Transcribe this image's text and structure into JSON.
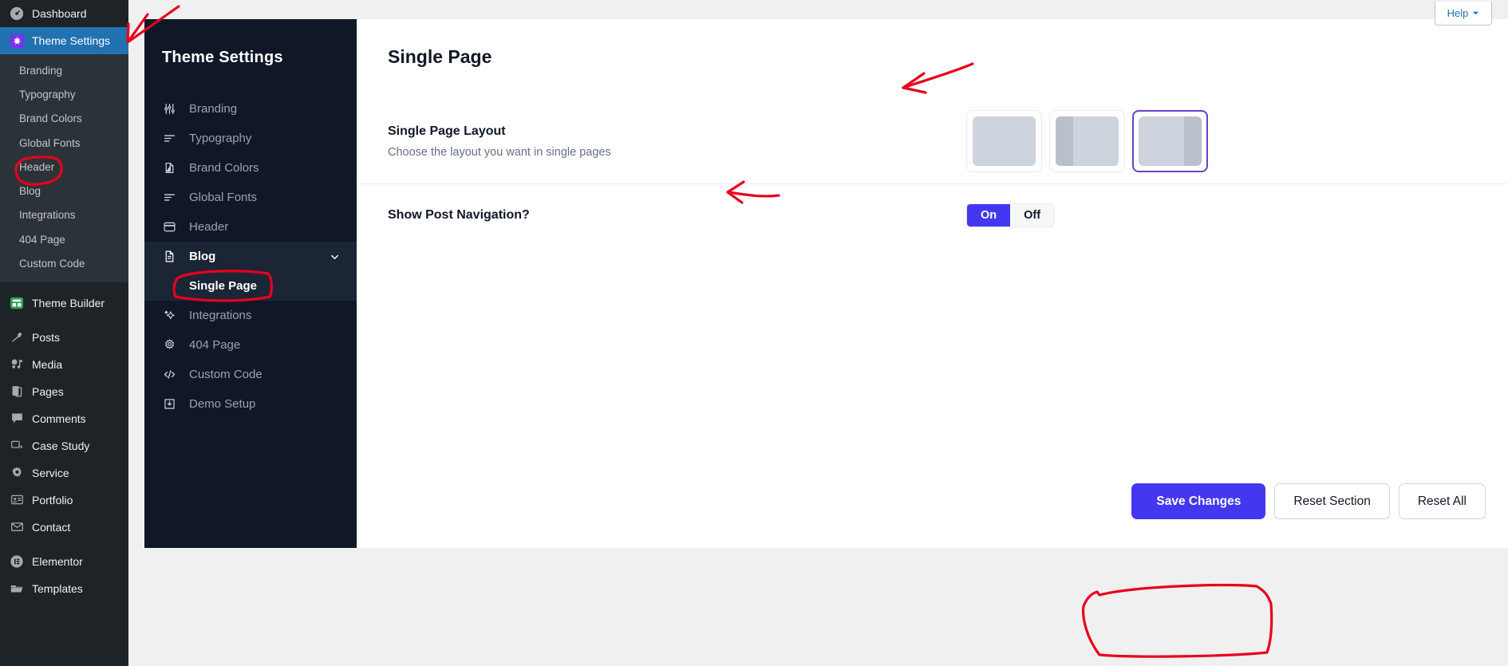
{
  "wp_sidebar": {
    "items": [
      {
        "label": "Dashboard",
        "icon": "dashboard-icon",
        "active": false
      },
      {
        "label": "Theme Settings",
        "icon": "theme-settings-icon",
        "active": true
      }
    ],
    "submenu": [
      {
        "label": "Branding"
      },
      {
        "label": "Typography"
      },
      {
        "label": "Brand Colors"
      },
      {
        "label": "Global Fonts"
      },
      {
        "label": "Header"
      },
      {
        "label": "Blog"
      },
      {
        "label": "Integrations"
      },
      {
        "label": "404 Page"
      },
      {
        "label": "Custom Code"
      }
    ],
    "items_after": [
      {
        "label": "Theme Builder",
        "icon": "theme-builder-icon"
      },
      {
        "label": "Posts",
        "icon": "pin-icon"
      },
      {
        "label": "Media",
        "icon": "media-icon"
      },
      {
        "label": "Pages",
        "icon": "pages-icon"
      },
      {
        "label": "Comments",
        "icon": "comment-icon"
      },
      {
        "label": "Case Study",
        "icon": "case-study-icon"
      },
      {
        "label": "Service",
        "icon": "gear-icon"
      },
      {
        "label": "Portfolio",
        "icon": "portfolio-icon"
      },
      {
        "label": "Contact",
        "icon": "envelope-icon"
      },
      {
        "label": "Elementor",
        "icon": "elementor-icon"
      },
      {
        "label": "Templates",
        "icon": "folder-icon"
      }
    ]
  },
  "help_tab": {
    "label": "Help"
  },
  "theme_panel": {
    "title": "Theme Settings",
    "items": [
      {
        "label": "Branding",
        "icon": "sliders-icon"
      },
      {
        "label": "Typography",
        "icon": "text-lines-icon"
      },
      {
        "label": "Brand Colors",
        "icon": "color-drop-icon"
      },
      {
        "label": "Global Fonts",
        "icon": "text-lines-icon"
      },
      {
        "label": "Header",
        "icon": "window-icon"
      },
      {
        "label": "Blog",
        "icon": "document-icon",
        "expanded": true,
        "chevron": "chevron-down-icon"
      },
      {
        "label": "Integrations",
        "icon": "sparkle-icon"
      },
      {
        "label": "404 Page",
        "icon": "gear-icon"
      },
      {
        "label": "Custom Code",
        "icon": "code-icon"
      },
      {
        "label": "Demo Setup",
        "icon": "demo-setup-icon"
      }
    ],
    "blog_child": {
      "label": "Single Page",
      "selected": true
    }
  },
  "main": {
    "page_title": "Single Page",
    "rows": [
      {
        "label": "Single Page Layout",
        "description": "Choose the layout you want in single pages"
      },
      {
        "label": "Show Post Navigation?",
        "description": ""
      }
    ],
    "layout_options": [
      {
        "name": "full-width",
        "sidebar": "none",
        "selected": false
      },
      {
        "name": "left-sidebar",
        "sidebar": "left",
        "selected": false
      },
      {
        "name": "right-sidebar",
        "sidebar": "right",
        "selected": true
      }
    ],
    "toggle": {
      "on_label": "On",
      "off_label": "Off",
      "value": "On"
    },
    "footer_buttons": [
      {
        "label": "Save Changes",
        "style": "primary"
      },
      {
        "label": "Reset Section",
        "style": "secondary"
      },
      {
        "label": "Reset All",
        "style": "secondary"
      }
    ]
  },
  "colors": {
    "accent": "#4338f0",
    "selected_border": "#6941c6",
    "wp_active": "#2271b1",
    "panel_bg": "#101828",
    "annotation": "#e8001c"
  }
}
